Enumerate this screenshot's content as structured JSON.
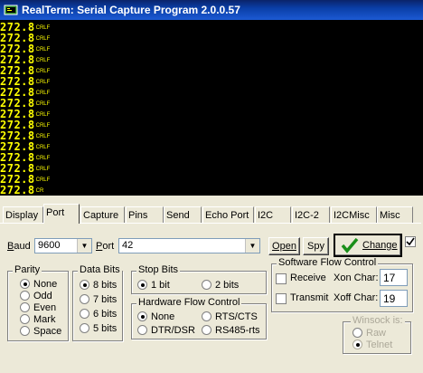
{
  "window": {
    "title": "RealTerm: Serial Capture Program 2.0.0.57"
  },
  "terminal": {
    "color": "#ffff00",
    "lines": [
      {
        "value": "272.8",
        "ctl": "CRLF"
      },
      {
        "value": "272.8",
        "ctl": "CRLF"
      },
      {
        "value": "272.8",
        "ctl": "CRLF"
      },
      {
        "value": "272.8",
        "ctl": "CRLF"
      },
      {
        "value": "272.8",
        "ctl": "CRLF"
      },
      {
        "value": "272.8",
        "ctl": "CRLF"
      },
      {
        "value": "272.8",
        "ctl": "CRLF"
      },
      {
        "value": "272.8",
        "ctl": "CRLF"
      },
      {
        "value": "272.8",
        "ctl": "CRLF"
      },
      {
        "value": "272.8",
        "ctl": "CRLF"
      },
      {
        "value": "272.8",
        "ctl": "CRLF"
      },
      {
        "value": "272.8",
        "ctl": "CRLF"
      },
      {
        "value": "272.8",
        "ctl": "CRLF"
      },
      {
        "value": "272.8",
        "ctl": "CRLF"
      },
      {
        "value": "272.8",
        "ctl": "CRLF"
      },
      {
        "value": "272.8",
        "ctl": "CR"
      }
    ]
  },
  "tabs": [
    "Display",
    "Port",
    "Capture",
    "Pins",
    "Send",
    "Echo Port",
    "I2C",
    "I2C-2",
    "I2CMisc",
    "Misc"
  ],
  "active_tab": "Port",
  "port": {
    "baud_label": "Baud",
    "baud_value": "9600",
    "port_label": "Port",
    "port_value": "42",
    "open_button": "Open",
    "spy_button": "Spy",
    "change_button": "Change"
  },
  "parity": {
    "title": "Parity",
    "options": [
      "None",
      "Odd",
      "Even",
      "Mark",
      "Space"
    ],
    "selected": "None"
  },
  "data_bits": {
    "title": "Data Bits",
    "options": [
      "8 bits",
      "7 bits",
      "6 bits",
      "5 bits"
    ],
    "selected": "8 bits"
  },
  "stop_bits": {
    "title": "Stop Bits",
    "options": [
      "1 bit",
      "2 bits"
    ],
    "selected": "1 bit"
  },
  "hw_flow": {
    "title": "Hardware Flow Control",
    "options": [
      "None",
      "RTS/CTS",
      "DTR/DSR",
      "RS485-rts"
    ],
    "selected": "None"
  },
  "sw_flow": {
    "title": "Software Flow Control",
    "receive_label": "Receive",
    "xon_label": "Xon Char:",
    "xon_value": "17",
    "transmit_label": "Transmit",
    "xoff_label": "Xoff Char:",
    "xoff_value": "19"
  },
  "winsock": {
    "title": "Winsock is:",
    "options": [
      "Raw",
      "Telnet"
    ],
    "selected": "Telnet"
  },
  "colors": {
    "terminal_bg": "#000000",
    "terminal_text": "#ffff00",
    "titlebar": "#0a246a",
    "panel": "#ece9d8"
  }
}
